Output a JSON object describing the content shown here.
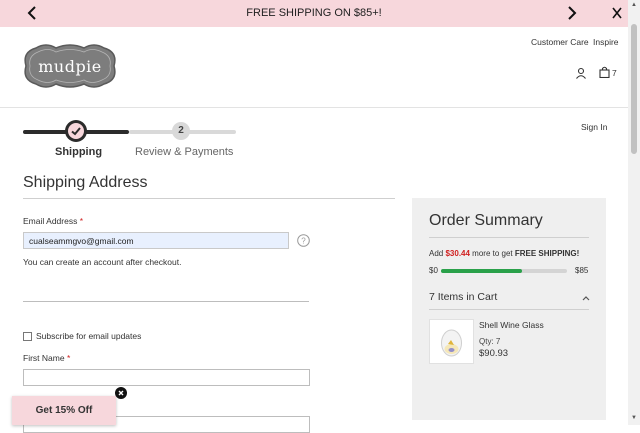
{
  "promo": {
    "text": "FREE SHIPPING ON $85+!",
    "prev_icon": "chevron-left-icon",
    "next_icon": "chevron-right-icon",
    "close_icon": "close-icon"
  },
  "header": {
    "logo_text": "mudpie",
    "links": [
      "Customer Care",
      "Inspire"
    ],
    "account_icon": "user-icon",
    "cart_icon": "shopping-bag-icon",
    "cart_count": "7",
    "sign_in": "Sign In"
  },
  "steps": [
    {
      "label": "Shipping",
      "state": "complete",
      "icon": "checkmark-icon"
    },
    {
      "label": "Review & Payments",
      "number": "2",
      "state": "upcoming"
    }
  ],
  "shipping": {
    "title": "Shipping Address",
    "email_label": "Email Address",
    "required_mark": "*",
    "email_value": "cualseammgvo@gmail.com",
    "help_icon": "question-circle-icon",
    "account_note": "You can create an account after checkout.",
    "subscribe_label": "Subscribe for email updates",
    "first_name_label": "First Name"
  },
  "summary": {
    "title": "Order Summary",
    "shipping_prefix": "Add ",
    "shipping_amount": "$30.44",
    "shipping_mid": " more to get ",
    "shipping_bold": "FREE SHIPPING!",
    "progress_min": "$0",
    "progress_max": "$85",
    "progress_fraction": 0.64,
    "items_heading": "7 Items in Cart",
    "collapse_icon": "chevron-up-icon",
    "item": {
      "name": "Shell Wine Glass",
      "qty": "Qty: 7",
      "price": "$90.93",
      "image_icon": "wine-glass-icon"
    }
  },
  "popup": {
    "text": "Get 15% Off",
    "close_icon": "close-icon"
  },
  "colors": {
    "promo_bg": "#f7d7dc",
    "accent_dark": "#2b2b2b",
    "progress_green": "#2aa14a",
    "price_red": "#d02020",
    "summary_bg": "#efefef"
  }
}
